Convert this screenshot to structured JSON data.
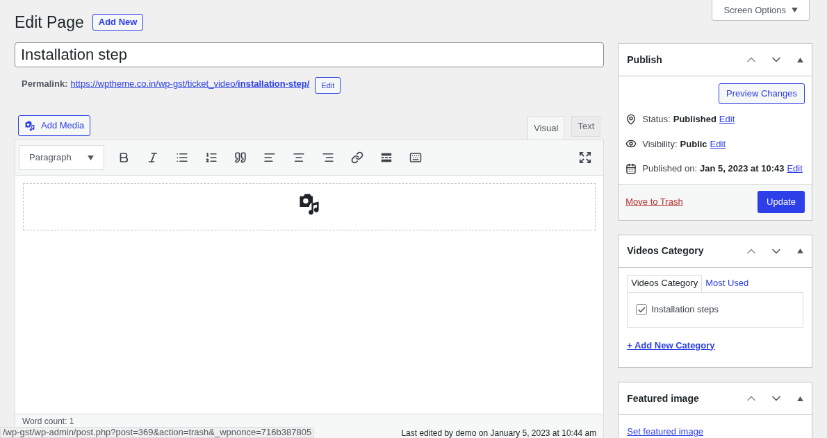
{
  "header": {
    "title": "Edit Page",
    "add_new": "Add New",
    "screen_options": "Screen Options"
  },
  "post_title": {
    "value": "Installation step"
  },
  "permalink": {
    "label": "Permalink:",
    "url": "https://wptheme.co.in/wp-gst/ticket_video/**installation-step/**",
    "edit": "Edit"
  },
  "add_media": "Add Media",
  "editor_tabs": [
    {
      "label": "Visual",
      "selected": true
    },
    {
      "label": "Text",
      "selected": false
    }
  ],
  "format_select": "Paragraph",
  "footer": {
    "word_count": "Word count: 1",
    "last_edited": "Last edited by demo on January 5, 2023 at 10:44 am"
  },
  "status_url": "/wp-gst/wp-admin/post.php?post=369&action=trash&_wpnonce=716b387805",
  "publish": {
    "title": "Publish",
    "preview": "Preview Changes",
    "rows": [
      {
        "kind": "status",
        "label": "Status:",
        "value": "Published",
        "edit": "Edit"
      },
      {
        "kind": "visibility",
        "label": "Visibility:",
        "value": "Public",
        "edit": "Edit"
      },
      {
        "kind": "date",
        "label": "Published on:",
        "value": "Jan 5, 2023 at 10:43",
        "edit": "Edit"
      }
    ],
    "trash": "Move to Trash",
    "update": "Update"
  },
  "videos_category": {
    "title": "Videos Category",
    "tabs": [
      {
        "label": "Videos Category",
        "selected": true
      },
      {
        "label": "Most Used",
        "selected": false
      }
    ],
    "items": [
      {
        "label": "Installation steps",
        "checked": true
      }
    ],
    "add_new": "+ Add New Category"
  },
  "featured_image": {
    "title": "Featured image",
    "link": "Set featured image"
  }
}
